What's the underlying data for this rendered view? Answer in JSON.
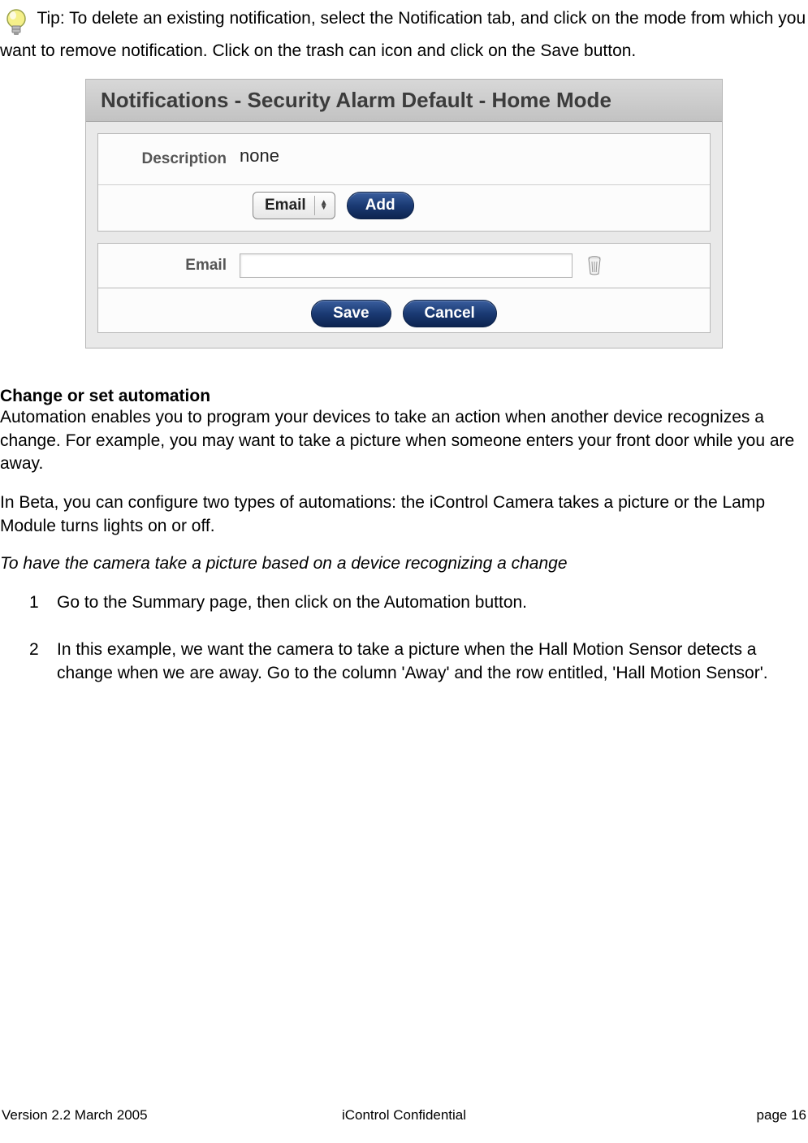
{
  "tip": {
    "text": "Tip: To delete an existing notification, select the Notification tab, and click on the mode from which you want to remove notification.  Click on the trash can icon and click on the Save button."
  },
  "screenshot": {
    "header": "Notifications - Security Alarm Default - Home Mode",
    "description_label": "Description",
    "description_value": "none",
    "select_value": "Email",
    "add_button": "Add",
    "email_label": "Email",
    "email_value": "",
    "save_button": "Save",
    "cancel_button": "Cancel"
  },
  "automation": {
    "heading": "Change or set automation",
    "para1": "Automation enables you to program your devices to take an action when another device recognizes a change.  For example, you may want to take a picture when someone enters your front door while you are away.",
    "para2": "In Beta, you can configure two types of automations: the iControl Camera takes a picture or the Lamp Module turns lights on or off.",
    "subheading": "To have the camera take a picture based on a device recognizing a change",
    "steps": [
      {
        "num": "1",
        "text": "Go to the Summary page, then click on the Automation button."
      },
      {
        "num": "2",
        "text": "In this example, we want the camera to take a picture when the Hall Motion Sensor detects a change when we are away. Go to the column 'Away' and the row entitled, 'Hall Motion Sensor'."
      }
    ]
  },
  "footer": {
    "left": "Version 2.2 March 2005",
    "center": "iControl     Confidential",
    "right": "page 16"
  }
}
